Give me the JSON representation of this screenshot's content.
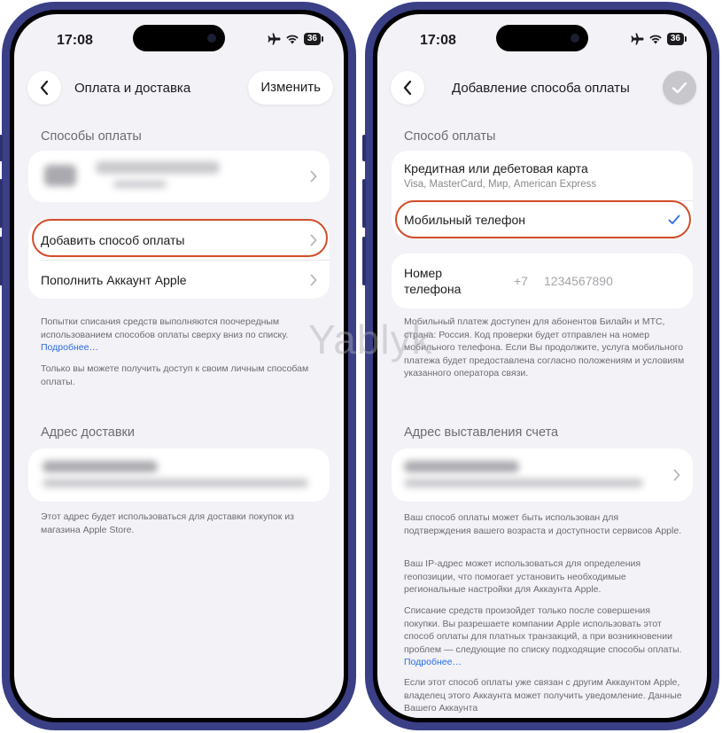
{
  "watermark": "Yablyk",
  "status_bar": {
    "time": "17:08",
    "battery": "36"
  },
  "left": {
    "nav": {
      "title": "Оплата и доставка",
      "edit_label": "Изменить"
    },
    "payment_methods": {
      "header": "Способы оплаты",
      "add_method": "Добавить способ оплаты",
      "top_up": "Пополнить Аккаунт Apple",
      "footnote1": "Попытки списания средств выполняются поочередным использованием способов оплаты сверху вниз по списку.",
      "footnote1_link": "Подробнее…",
      "footnote2": "Только вы можете получить доступ к своим личным способам оплаты."
    },
    "shipping": {
      "header": "Адрес доставки",
      "footnote": "Этот адрес будет использоваться для доставки покупок из магазина Apple Store."
    }
  },
  "right": {
    "nav": {
      "title": "Добавление способа оплаты"
    },
    "payment_method": {
      "header": "Способ оплаты",
      "card_option": "Кредитная или дебетовая карта",
      "card_sub": "Visa, MasterCard, Мир, American Express",
      "mobile_option": "Мобильный телефон"
    },
    "phone": {
      "label": "Номер телефона",
      "prefix": "+7",
      "placeholder": "1234567890"
    },
    "mobile_note": "Мобильный платеж доступен для абонентов Билайн и МТС, страна: Россия. Код проверки будет отправлен на номер мобильного телефона. Если Вы продолжите, услуга мобильного платежа будет предоставлена согласно положениям и условиям указанного оператора связи.",
    "billing": {
      "header": "Адрес выставления счета",
      "note1": "Ваш способ оплаты может быть использован для подтверждения вашего возраста и доступности сервисов Apple.",
      "note2": "Ваш IP-адрес может использоваться для определения геопозиции, что помогает установить необходимые региональные настройки для Аккаунта Apple.",
      "note3": "Списание средств произойдет только после совершения покупки. Вы разрешаете компании Apple использовать этот способ оплаты для платных транзакций, а при возникновении проблем — следующие по списку подходящие способы оплаты.",
      "note3_link": "Подробнее…",
      "note4": "Если этот способ оплаты уже связан с другим Аккаунтом Apple, владелец этого Аккаунта может получить уведомление. Данные Вашего Аккаунта"
    }
  },
  "colors": {
    "accent": "#2b6ce6",
    "highlight": "#d24d2a",
    "frame": "#3a3f86"
  },
  "icons": [
    "back-chevron-icon",
    "chevron-right-icon",
    "checkmark-icon",
    "airplane-icon",
    "wifi-icon",
    "battery-icon"
  ]
}
